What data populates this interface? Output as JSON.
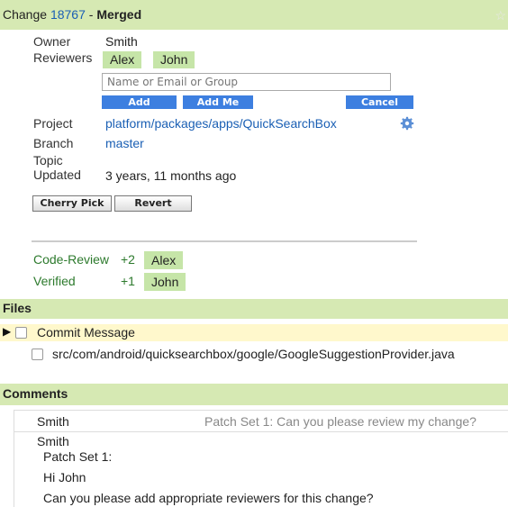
{
  "header": {
    "prefix": "Change",
    "change_number": "18767",
    "separator": "-",
    "status": "Merged",
    "star_glyph": "☆"
  },
  "details": {
    "owner_label": "Owner",
    "owner": "Smith",
    "reviewers_label": "Reviewers",
    "reviewers": [
      "Alex",
      "John"
    ],
    "reviewer_input_placeholder": "Name or Email or Group",
    "add_label": "Add",
    "add_me_label": "Add Me",
    "cancel_label": "Cancel",
    "project_label": "Project",
    "project": "platform/packages/apps/QuickSearchBox",
    "branch_label": "Branch",
    "branch": "master",
    "topic_label": "Topic",
    "updated_label": "Updated",
    "updated": "3 years, 11 months ago",
    "cherry_pick_label": "Cherry Pick",
    "revert_label": "Revert"
  },
  "labels": [
    {
      "name": "Code-Review",
      "score": "+2",
      "who": "Alex"
    },
    {
      "name": "Verified",
      "score": "+1",
      "who": "John"
    }
  ],
  "files": {
    "title": "Files",
    "items": [
      "Commit Message",
      "src/com/android/quicksearchbox/google/GoogleSuggestionProvider.java"
    ]
  },
  "comments": {
    "title": "Comments",
    "collapsed": {
      "author": "Smith",
      "summary": "Patch Set 1: Can you please review my change?"
    },
    "expanded": {
      "author": "Smith",
      "patch_set": "Patch Set 1:",
      "greeting": "Hi John",
      "body": "Can you please add appropriate reviewers for this change?"
    }
  },
  "colors": {
    "header_bg": "#d6e9b3",
    "chip_bg": "#c6e5a8",
    "link": "#1a5fb4",
    "button_blue": "#3d7fe0"
  }
}
